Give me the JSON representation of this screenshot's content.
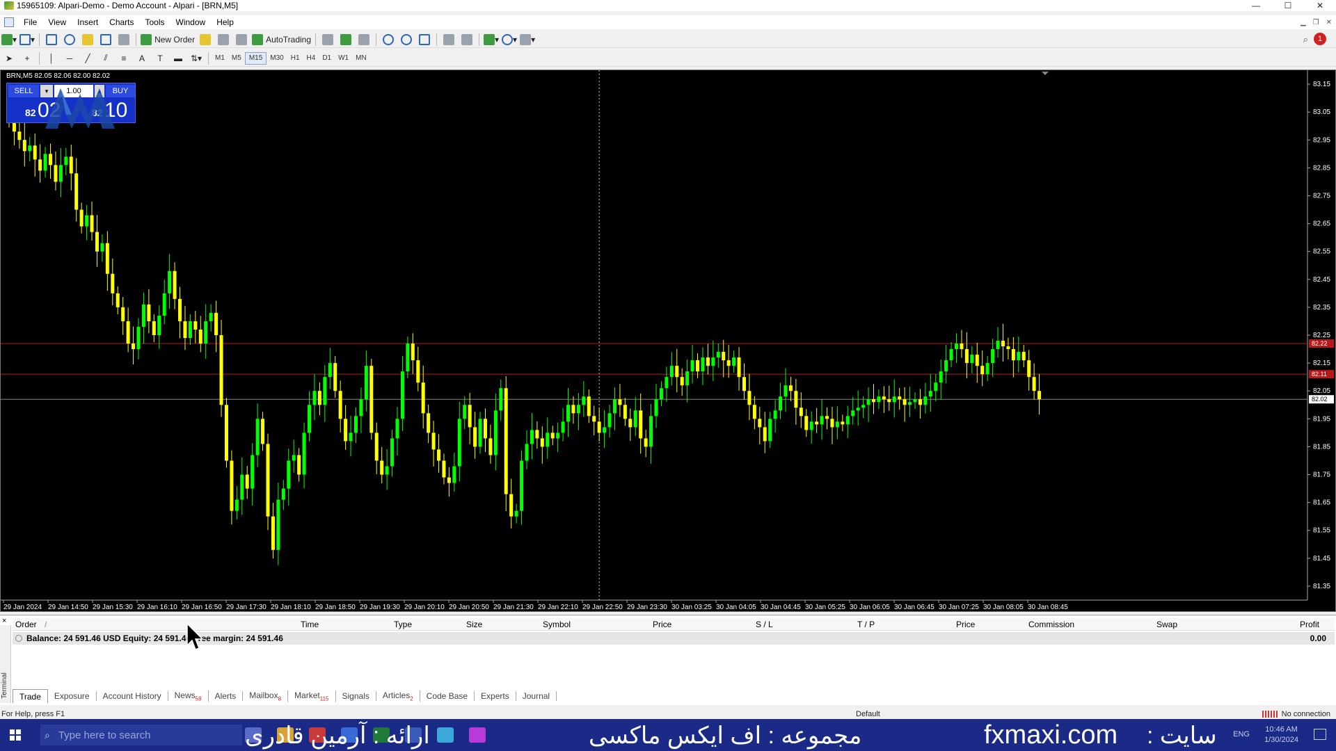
{
  "window": {
    "title": "15965109: Alpari-Demo - Demo Account - Alpari - [BRN,M5]",
    "controls": [
      "—",
      "☐",
      "✕"
    ]
  },
  "menu": [
    "File",
    "View",
    "Insert",
    "Charts",
    "Tools",
    "Window",
    "Help"
  ],
  "toolbar": {
    "new_order_label": "New Order",
    "autotrading_label": "AutoTrading",
    "timeframes": [
      "M1",
      "M5",
      "M15",
      "M30",
      "H1",
      "H4",
      "D1",
      "W1",
      "MN"
    ],
    "active_timeframe": "M15",
    "notification_count": "1"
  },
  "chart": {
    "symbol_info": "BRN,M5  82.05 82.06 82.00 82.02",
    "background": "#000000",
    "bull_color": "#00ff00",
    "bear_color": "#ffff00",
    "level_color": "#b81818"
  },
  "one_click": {
    "sell_label": "SELL",
    "buy_label": "BUY",
    "volume": "1.00",
    "bid_small": "82",
    "bid_big": "02",
    "ask_small": "82",
    "ask_big": "10"
  },
  "chart_data": {
    "type": "candlestick",
    "ylim": [
      81.3,
      83.2
    ],
    "y_ticks": [
      "83.15",
      "83.05",
      "82.95",
      "82.85",
      "82.75",
      "82.65",
      "82.55",
      "82.45",
      "82.35",
      "82.25",
      "82.15",
      "82.05",
      "81.95",
      "81.85",
      "81.75",
      "81.65",
      "81.55",
      "81.45",
      "81.35"
    ],
    "x_ticks": [
      "29 Jan 2024",
      "29 Jan 14:50",
      "29 Jan 15:30",
      "29 Jan 16:10",
      "29 Jan 16:50",
      "29 Jan 17:30",
      "29 Jan 18:10",
      "29 Jan 18:50",
      "29 Jan 19:30",
      "29 Jan 20:10",
      "29 Jan 20:50",
      "29 Jan 21:30",
      "29 Jan 22:10",
      "29 Jan 22:50",
      "29 Jan 23:30",
      "30 Jan 03:25",
      "30 Jan 04:05",
      "30 Jan 04:45",
      "30 Jan 05:25",
      "30 Jan 06:05",
      "30 Jan 06:45",
      "30 Jan 07:25",
      "30 Jan 08:05",
      "30 Jan 08:45"
    ],
    "levels": [
      {
        "price": 82.22,
        "label": "82.22"
      },
      {
        "price": 82.11,
        "label": "82.11"
      }
    ],
    "current_price": {
      "price": 82.02,
      "label": "82.02"
    },
    "period_separator_index": 114,
    "closes": [
      83.02,
      82.98,
      82.95,
      82.91,
      82.93,
      82.88,
      82.84,
      82.9,
      82.86,
      82.8,
      82.86,
      82.89,
      82.83,
      82.7,
      82.64,
      82.68,
      82.62,
      82.55,
      82.58,
      82.47,
      82.4,
      82.35,
      82.3,
      82.22,
      82.2,
      82.28,
      82.36,
      82.3,
      82.25,
      82.32,
      82.4,
      82.48,
      82.38,
      82.3,
      82.24,
      82.3,
      82.27,
      82.22,
      82.3,
      82.33,
      82.25,
      82.0,
      81.8,
      81.62,
      81.66,
      81.75,
      81.7,
      81.82,
      81.95,
      81.86,
      81.6,
      81.48,
      81.66,
      81.7,
      81.8,
      81.82,
      81.75,
      81.9,
      82.0,
      82.05,
      82.0,
      82.1,
      82.15,
      82.05,
      81.95,
      81.87,
      81.9,
      81.96,
      82.02,
      82.14,
      81.9,
      81.8,
      81.75,
      81.78,
      81.88,
      81.95,
      82.12,
      82.22,
      82.16,
      82.08,
      81.97,
      81.9,
      81.84,
      81.8,
      81.74,
      81.72,
      81.78,
      81.95,
      82.0,
      81.92,
      81.85,
      81.95,
      81.88,
      81.82,
      81.98,
      82.06,
      81.68,
      81.6,
      81.62,
      81.8,
      81.86,
      81.91,
      81.88,
      81.85,
      81.9,
      81.88,
      81.9,
      81.94,
      82.0,
      81.97,
      82.0,
      82.03,
      81.96,
      81.94,
      81.9,
      81.92,
      81.97,
      82.02,
      82.0,
      81.95,
      81.92,
      81.98,
      81.88,
      81.85,
      81.96,
      82.02,
      82.06,
      82.1,
      82.14,
      82.1,
      82.07,
      82.12,
      82.16,
      82.12,
      82.17,
      82.14,
      82.17,
      82.19,
      82.16,
      82.14,
      82.17,
      82.1,
      82.05,
      82.0,
      81.95,
      81.92,
      81.87,
      81.95,
      81.98,
      82.03,
      82.07,
      82.05,
      81.99,
      81.96,
      81.91,
      81.94,
      81.93,
      81.96,
      81.95,
      81.92,
      81.94,
      81.93,
      81.96,
      81.98,
      81.99,
      82.0,
      82.02,
      82.01,
      82.03,
      82.02,
      82.01,
      82.03,
      82.02,
      82.0,
      82.01,
      82.02,
      82.0,
      82.03,
      82.05,
      82.08,
      82.12,
      82.16,
      82.2,
      82.22,
      82.2,
      82.15,
      82.18,
      82.14,
      82.11,
      82.15,
      82.2,
      82.23,
      82.21,
      82.2,
      82.16,
      82.19,
      82.16,
      82.1,
      82.05,
      82.02
    ]
  },
  "terminal": {
    "close_label": "×",
    "side_label": "Terminal",
    "columns": [
      "Order",
      "/",
      "Time",
      "Type",
      "Size",
      "Symbol",
      "Price",
      "S / L",
      "T / P",
      "Price",
      "Commission",
      "Swap",
      "Profit"
    ],
    "balance_text": "Balance: 24 591.46 USD   Equity: 24 591.46   Free margin: 24 591.46",
    "profit": "0.00",
    "tabs": [
      {
        "label": "Trade",
        "badge": ""
      },
      {
        "label": "Exposure",
        "badge": ""
      },
      {
        "label": "Account History",
        "badge": ""
      },
      {
        "label": "News",
        "badge": "59"
      },
      {
        "label": "Alerts",
        "badge": ""
      },
      {
        "label": "Mailbox",
        "badge": "8"
      },
      {
        "label": "Market",
        "badge": "115"
      },
      {
        "label": "Signals",
        "badge": ""
      },
      {
        "label": "Articles",
        "badge": "2"
      },
      {
        "label": "Code Base",
        "badge": ""
      },
      {
        "label": "Experts",
        "badge": ""
      },
      {
        "label": "Journal",
        "badge": ""
      }
    ]
  },
  "statusbar": {
    "help": "For Help, press F1",
    "profile": "Default",
    "connection": "No connection"
  },
  "taskbar": {
    "search_placeholder": "Type here to search",
    "overlay_presenter": "ارائه : آرمین قادری",
    "overlay_collection": "مجموعه : اف ایکس ماکسی",
    "overlay_site_label": "سایت :",
    "site": "fxmaxi.com",
    "time": "10:46 AM",
    "date": "1/30/2024",
    "lang": "ENG"
  }
}
